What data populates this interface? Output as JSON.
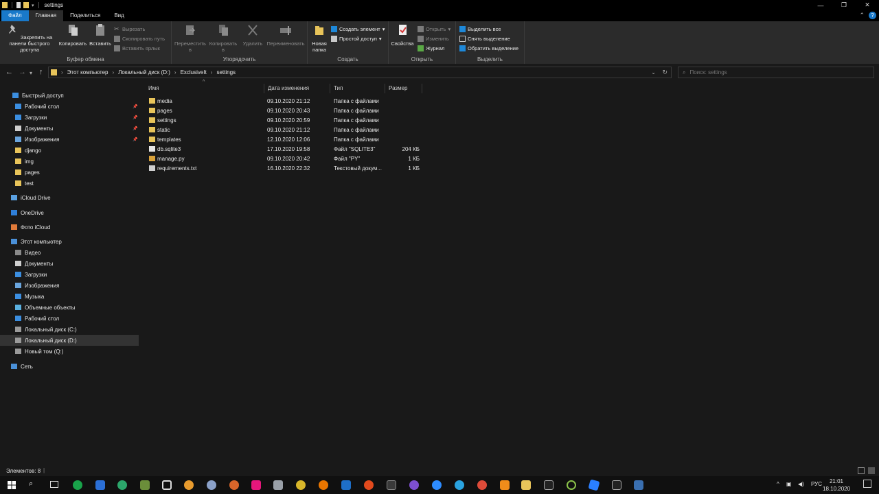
{
  "window": {
    "title": "settings"
  },
  "tabs": {
    "file": "Файл",
    "home": "Главная",
    "share": "Поделиться",
    "view": "Вид"
  },
  "ribbon": {
    "clipboard": {
      "label": "Буфер обмена",
      "pin": "Закрепить на панели быстрого доступа",
      "copy": "Копировать",
      "paste": "Вставить",
      "cut": "Вырезать",
      "copy_path": "Скопировать путь",
      "paste_shortcut": "Вставить ярлык"
    },
    "organize": {
      "label": "Упорядочить",
      "move_to": "Переместить в",
      "copy_to": "Копировать в",
      "delete": "Удалить",
      "rename": "Переименовать"
    },
    "create": {
      "label": "Создать",
      "new_folder": "Новая папка",
      "new_item": "Создать элемент",
      "easy_access": "Простой доступ"
    },
    "open": {
      "label": "Открыть",
      "properties": "Свойства",
      "open": "Открыть",
      "edit": "Изменить",
      "history": "Журнал"
    },
    "select": {
      "label": "Выделить",
      "select_all": "Выделить все",
      "select_none": "Снять выделение",
      "invert": "Обратить выделение"
    }
  },
  "address": {
    "crumbs": [
      "Этот компьютер",
      "Локальный диск (D:)",
      "ExclusiveIt",
      "settings"
    ]
  },
  "search": {
    "placeholder": "Поиск: settings"
  },
  "sidebar": {
    "items": [
      {
        "label": "Быстрый доступ",
        "icon": "star-icon"
      },
      {
        "label": "Рабочий стол",
        "icon": "desktop-icon"
      },
      {
        "label": "Загрузки",
        "icon": "download-icon"
      },
      {
        "label": "Документы",
        "icon": "document-icon"
      },
      {
        "label": "Изображения",
        "icon": "image-icon"
      },
      {
        "label": "django",
        "icon": "folder-icon"
      },
      {
        "label": "img",
        "icon": "folder-icon"
      },
      {
        "label": "pages",
        "icon": "folder-icon"
      },
      {
        "label": "test",
        "icon": "folder-icon"
      },
      {
        "label": "iCloud Drive",
        "icon": "icloud-icon"
      },
      {
        "label": "OneDrive",
        "icon": "onedrive-icon"
      },
      {
        "label": "Фото iCloud",
        "icon": "photos-icon"
      },
      {
        "label": "Этот компьютер",
        "icon": "computer-icon"
      },
      {
        "label": "Видео",
        "icon": "video-icon"
      },
      {
        "label": "Документы",
        "icon": "document-icon"
      },
      {
        "label": "Загрузки",
        "icon": "download-icon"
      },
      {
        "label": "Изображения",
        "icon": "image-icon"
      },
      {
        "label": "Музыка",
        "icon": "music-icon"
      },
      {
        "label": "Объемные объекты",
        "icon": "3d-objects-icon"
      },
      {
        "label": "Рабочий стол",
        "icon": "desktop-icon"
      },
      {
        "label": "Локальный диск (C:)",
        "icon": "drive-icon"
      },
      {
        "label": "Локальный диск (D:)",
        "icon": "drive-icon"
      },
      {
        "label": "Новый том (Q:)",
        "icon": "drive-icon"
      },
      {
        "label": "Сеть",
        "icon": "network-icon"
      }
    ]
  },
  "columns": {
    "name": "Имя",
    "date": "Дата изменения",
    "type": "Тип",
    "size": "Размер"
  },
  "files": [
    {
      "name": "media",
      "date": "09.10.2020 21:12",
      "type": "Папка с файлами",
      "size": "",
      "icon": "folder-icon"
    },
    {
      "name": "pages",
      "date": "09.10.2020 20:43",
      "type": "Папка с файлами",
      "size": "",
      "icon": "folder-icon"
    },
    {
      "name": "settings",
      "date": "09.10.2020 20:59",
      "type": "Папка с файлами",
      "size": "",
      "icon": "folder-icon"
    },
    {
      "name": "static",
      "date": "09.10.2020 21:12",
      "type": "Папка с файлами",
      "size": "",
      "icon": "folder-icon"
    },
    {
      "name": "templates",
      "date": "12.10.2020 12:06",
      "type": "Папка с файлами",
      "size": "",
      "icon": "folder-icon"
    },
    {
      "name": "db.sqlite3",
      "date": "17.10.2020 19:58",
      "type": "Файл \"SQLITE3\"",
      "size": "204 КБ",
      "icon": "file-icon"
    },
    {
      "name": "manage.py",
      "date": "09.10.2020 20:42",
      "type": "Файл \"PY\"",
      "size": "1 КБ",
      "icon": "python-file-icon"
    },
    {
      "name": "requirements.txt",
      "date": "16.10.2020 22:32",
      "type": "Текстовый докум...",
      "size": "1 КБ",
      "icon": "text-file-icon"
    }
  ],
  "status": {
    "count": "Элементов: 8"
  },
  "taskbar": {
    "lang": "РУС",
    "time": "21:01",
    "date": "18.10.2020"
  }
}
